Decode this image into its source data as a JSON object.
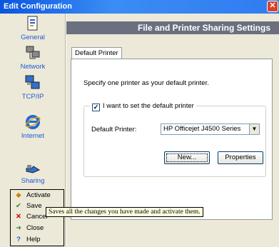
{
  "window": {
    "title": "Edit Configuration",
    "close_glyph": "✕"
  },
  "sidebar": {
    "items": [
      {
        "label": "General",
        "icon": "document-icon"
      },
      {
        "label": "Network",
        "icon": "network-icon"
      },
      {
        "label": "TCP/IP",
        "icon": "computers-icon"
      },
      {
        "label": "Internet",
        "icon": "internet-explorer-icon"
      },
      {
        "label": "Sharing",
        "icon": "sharing-icon"
      }
    ]
  },
  "actions": {
    "activate": "Activate",
    "save": "Save",
    "cancel": "Cancel",
    "close": "Close",
    "help": "Help"
  },
  "main": {
    "header": "File and Printer Sharing Settings",
    "tab": "Default Printer",
    "intro": "Specify one printer as your default printer.",
    "checkbox_label": "I want to set the default printer",
    "checkbox_checked": true,
    "printer_label": "Default Printer:",
    "printer_value": "HP Officejet J4500 Series",
    "new_button": "New...",
    "properties_button": "Properties"
  },
  "tooltip": "Saves all the changes you have made and activate them."
}
